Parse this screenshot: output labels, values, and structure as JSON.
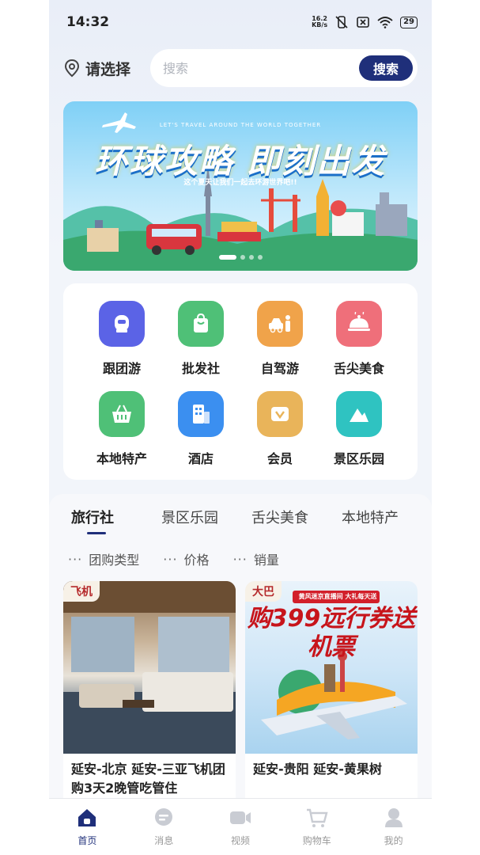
{
  "status_bar": {
    "time": "14:32",
    "net_speed_value": "16.2",
    "net_speed_unit": "KB/s",
    "battery": "29"
  },
  "header": {
    "location_label": "请选择",
    "search_placeholder": "搜索",
    "search_button": "搜索"
  },
  "banner": {
    "subtitle": "LET'S TRAVEL AROUND THE WORLD TOGETHER",
    "title": "环球攻略 即刻出发",
    "tagline": "这个夏天让我们一起去环游世界吧!!",
    "slide_count": 4,
    "active_slide": 1
  },
  "categories": [
    {
      "label": "跟团游",
      "icon": "tour-group-icon",
      "color": "#5b63e6"
    },
    {
      "label": "批发社",
      "icon": "shopping-bag-icon",
      "color": "#4fc077"
    },
    {
      "label": "自驾游",
      "icon": "self-drive-icon",
      "color": "#f0a34a"
    },
    {
      "label": "舌尖美食",
      "icon": "food-cloche-icon",
      "color": "#ef6f7a"
    },
    {
      "label": "本地特产",
      "icon": "basket-icon",
      "color": "#4fc077"
    },
    {
      "label": "酒店",
      "icon": "hotel-icon",
      "color": "#3b8ff0"
    },
    {
      "label": "会员",
      "icon": "member-card-icon",
      "color": "#e9b45a"
    },
    {
      "label": "景区乐园",
      "icon": "scenic-mountain-icon",
      "color": "#2fc3c1"
    }
  ],
  "tabs": [
    {
      "label": "旅行社",
      "active": true
    },
    {
      "label": "景区乐园",
      "active": false
    },
    {
      "label": "舌尖美食",
      "active": false
    },
    {
      "label": "本地特产",
      "active": false
    }
  ],
  "filters": [
    {
      "dots": "···",
      "label": "团购类型"
    },
    {
      "dots": "···",
      "label": "价格"
    },
    {
      "dots": "···",
      "label": "销量"
    }
  ],
  "products": [
    {
      "badge": "飞机",
      "title": "延安-北京 延安-三亚飞机团购3天2晚管吃管住"
    },
    {
      "badge": "大巴",
      "title": "延安-贵阳 延安-黄果树",
      "promo_top": "黄风迷京直播间 大礼每天送",
      "promo_text": "购399远行券送机票"
    }
  ],
  "bottom_nav": [
    {
      "label": "首页",
      "icon": "home-icon",
      "active": true
    },
    {
      "label": "消息",
      "icon": "message-icon",
      "active": false
    },
    {
      "label": "视频",
      "icon": "video-icon",
      "active": false
    },
    {
      "label": "购物车",
      "icon": "cart-icon",
      "active": false
    },
    {
      "label": "我的",
      "icon": "profile-icon",
      "active": false
    }
  ],
  "colors": {
    "brand": "#1f2f7a",
    "badge_text": "#b5292b",
    "page_bg": "#f3f5f9"
  }
}
